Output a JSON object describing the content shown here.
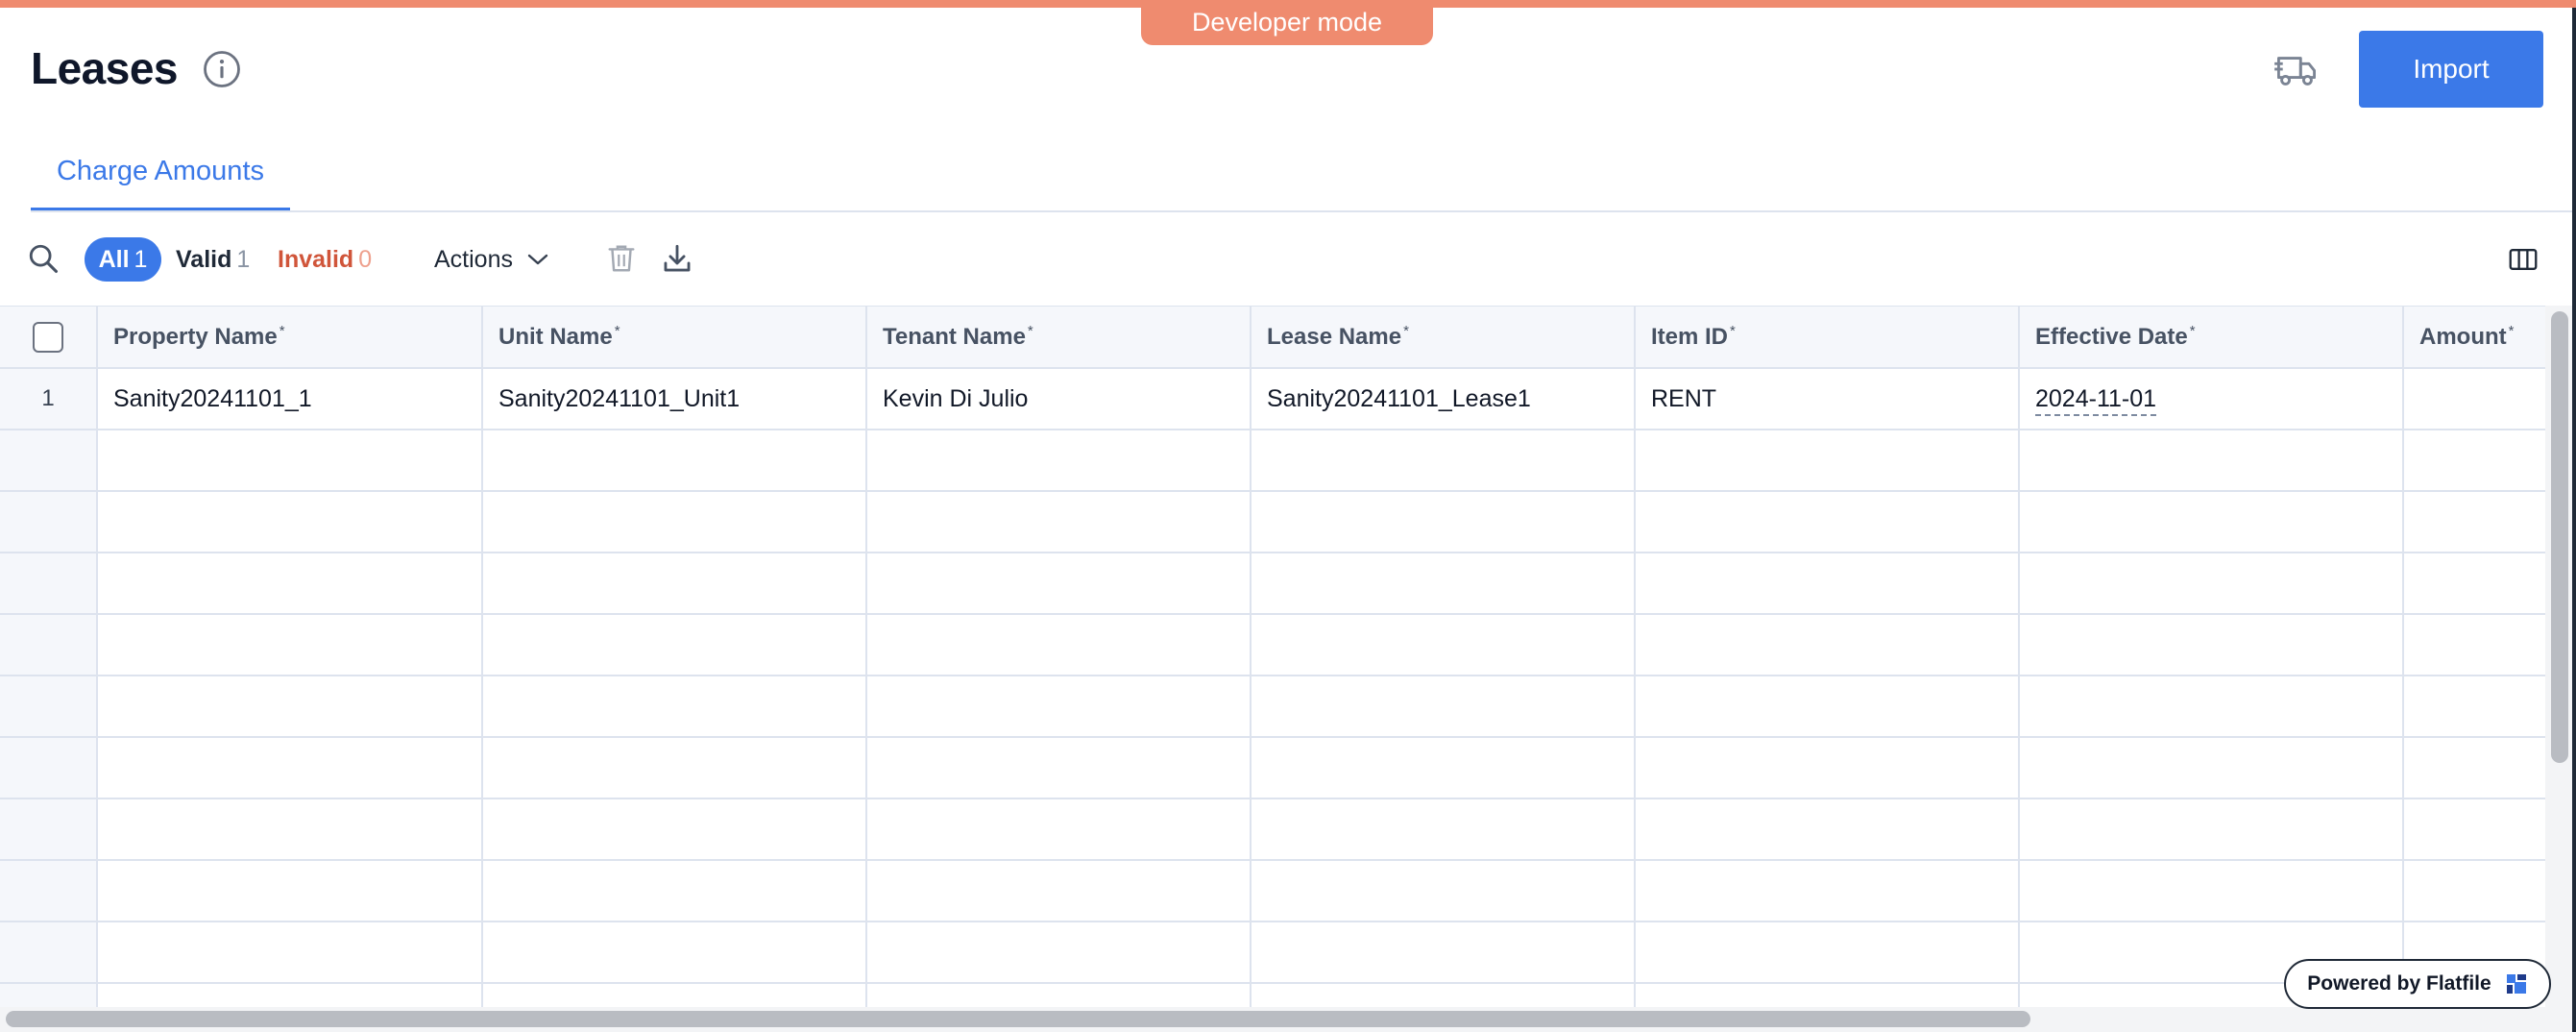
{
  "banner": {
    "label": "Developer mode"
  },
  "header": {
    "title": "Leases",
    "import_label": "Import"
  },
  "tabs": [
    {
      "label": "Charge Amounts"
    }
  ],
  "toolbar": {
    "filters": [
      {
        "label": "All",
        "count": "1"
      },
      {
        "label": "Valid",
        "count": "1"
      },
      {
        "label": "Invalid",
        "count": "0"
      }
    ],
    "actions_label": "Actions"
  },
  "grid": {
    "required_marker": "*",
    "columns": [
      "Property Name",
      "Unit Name",
      "Tenant Name",
      "Lease Name",
      "Item ID",
      "Effective Date",
      "Amount"
    ],
    "rows": [
      {
        "index": "1",
        "cells": [
          "Sanity20241101_1",
          "Sanity20241101_Unit1",
          "Kevin Di Julio",
          "Sanity20241101_Lease1",
          "RENT",
          "2024-11-01",
          ""
        ]
      }
    ]
  },
  "footer": {
    "powered_by": "Powered by Flatfile"
  },
  "colors": {
    "accent": "#3b79e8",
    "developer_banner": "#ef8b6f",
    "invalid": "#d0553a"
  },
  "icons": [
    "info-icon",
    "truck-icon",
    "search-icon",
    "trash-icon",
    "download-icon",
    "columns-icon",
    "chevron-down-icon",
    "flatfile-logo-icon"
  ]
}
